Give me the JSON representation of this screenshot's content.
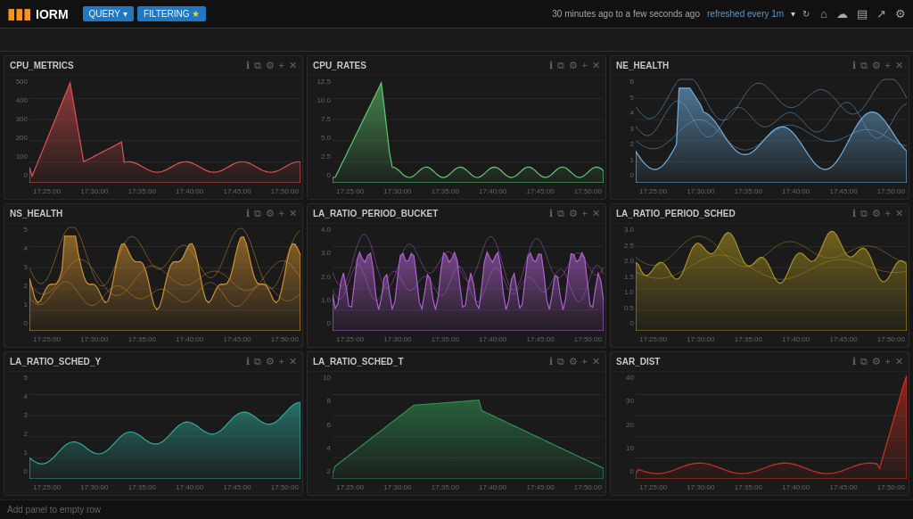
{
  "app": {
    "logo": "IORM",
    "logo_icon": "▮▮▮"
  },
  "topbar": {
    "query_label": "QUERY",
    "filtering_label": "FILTERING",
    "time_range": "30 minutes ago to a few seconds ago",
    "refresh_text": "refreshed every 1m",
    "refresh_icon": "▾",
    "icons": [
      "⌂",
      "☁",
      "▤",
      "↗",
      "⚙"
    ]
  },
  "panels": [
    {
      "id": "p1",
      "title": "CPU_METRICS",
      "color": "#e8a0a0",
      "fill_color": "rgba(220,100,100,0.4)",
      "stroke_color": "#e05050",
      "y_labels": [
        "500",
        "400",
        "300",
        "200",
        "100",
        "0"
      ],
      "x_labels": [
        "17:25:00",
        "17:30:00",
        "17:35:00",
        "17:40:00",
        "17:45:00",
        "17:50:00"
      ],
      "type": "area",
      "chart_variant": "spike_early"
    },
    {
      "id": "p2",
      "title": "CPU_RATES",
      "color": "#90e890",
      "fill_color": "rgba(80,200,120,0.3)",
      "stroke_color": "#60c870",
      "y_labels": [
        "12.5",
        "10.0",
        "7.5",
        "5.0",
        "2.5",
        "0"
      ],
      "x_labels": [
        "17:25:00",
        "17:30:00",
        "17:35:00",
        "17:40:00",
        "17:45:00",
        "17:50:00"
      ],
      "type": "area",
      "chart_variant": "spike_early_thin"
    },
    {
      "id": "p3",
      "title": "NE_HEALTH",
      "color": "#90c8e8",
      "fill_color": "rgba(100,180,220,0.3)",
      "stroke_color": "#70b0e0",
      "y_labels": [
        "6",
        "5",
        "4",
        "3",
        "2",
        "1",
        "0"
      ],
      "x_labels": [
        "17:25:00",
        "17:30:00",
        "17:35:00",
        "17:40:00",
        "17:45:00",
        "17:50:00"
      ],
      "type": "multi_area",
      "chart_variant": "multi_line_blue"
    },
    {
      "id": "p4",
      "title": "NS_HEALTH",
      "color": "#e8c080",
      "fill_color": "rgba(220,160,80,0.3)",
      "stroke_color": "#d09030",
      "y_labels": [
        "5",
        "4",
        "3",
        "2",
        "1",
        "0"
      ],
      "x_labels": [
        "17:25:00",
        "17:30:00",
        "17:35:00",
        "17:40:00",
        "17:45:00",
        "17:50:00"
      ],
      "type": "multi_area",
      "chart_variant": "multi_orange"
    },
    {
      "id": "p5",
      "title": "LA_RATIO_PERIOD_BUCKET",
      "color": "#c890e0",
      "fill_color": "rgba(180,100,220,0.35)",
      "stroke_color": "#b060d0",
      "y_labels": [
        "4.0",
        "3.0",
        "2.0",
        "1.0",
        "0"
      ],
      "x_labels": [
        "17:25:00",
        "17:30:00",
        "17:35:00",
        "17:40:00",
        "17:45:00",
        "17:50:00"
      ],
      "type": "multi_area",
      "chart_variant": "purple_noisy"
    },
    {
      "id": "p6",
      "title": "LA_RATIO_PERIOD_SCHED",
      "color": "#c8b840",
      "fill_color": "rgba(180,160,40,0.4)",
      "stroke_color": "#a89020",
      "y_labels": [
        "3.0",
        "2.5",
        "2.0",
        "1.5",
        "1.0",
        "0.5",
        "0"
      ],
      "x_labels": [
        "17:25:00",
        "17:30:00",
        "17:35:00",
        "17:40:00",
        "17:45:00",
        "17:50:00"
      ],
      "type": "multi_area",
      "chart_variant": "gold_flat"
    },
    {
      "id": "p7",
      "title": "LA_RATIO_SCHED_Y",
      "color": "#40b8a8",
      "fill_color": "rgba(40,160,150,0.35)",
      "stroke_color": "#30a898",
      "y_labels": [
        "5",
        "4",
        "3",
        "2",
        "1",
        "0"
      ],
      "x_labels": [
        "17:25:00",
        "17:30:00",
        "17:35:00",
        "17:40:00",
        "17:45:00",
        "17:50:00"
      ],
      "type": "area",
      "chart_variant": "teal_growing"
    },
    {
      "id": "p8",
      "title": "LA_RATIO_SCHED_T",
      "color": "#40a860",
      "fill_color": "rgba(40,150,70,0.35)",
      "stroke_color": "#309050",
      "y_labels": [
        "10",
        "8",
        "6",
        "4",
        "2"
      ],
      "x_labels": [
        "17:25:00",
        "17:30:00",
        "17:35:00",
        "17:40:00",
        "17:45:00",
        "17:50:00"
      ],
      "type": "area",
      "chart_variant": "green_hump"
    },
    {
      "id": "p9",
      "title": "SAR_DIST",
      "color": "#e04030",
      "fill_color": "rgba(220,60,40,0.4)",
      "stroke_color": "#d03020",
      "y_labels": [
        "40",
        "30",
        "20",
        "10",
        "0"
      ],
      "x_labels": [
        "17:25:00",
        "17:30:00",
        "17:35:00",
        "17:40:00",
        "17:45:00",
        "17:50:00"
      ],
      "type": "area",
      "chart_variant": "red_spike_end"
    }
  ],
  "add_panel": "Add panel to empty row",
  "panel_icons": {
    "info": "ℹ",
    "copy": "⧉",
    "settings": "⚙",
    "add": "+",
    "close": "✕"
  }
}
